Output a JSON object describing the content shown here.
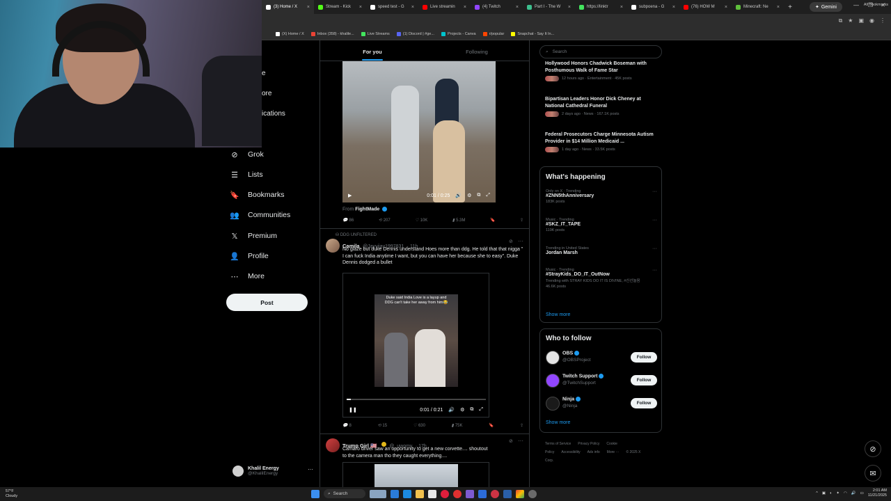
{
  "browser": {
    "tabs": [
      {
        "label": "(3) Home / X",
        "color": "#ffffff",
        "active": true
      },
      {
        "label": "Stream - Kick",
        "color": "#53fc18"
      },
      {
        "label": "speed test - G",
        "color": "#ffffff"
      },
      {
        "label": "Live streamin",
        "color": "#ff0000"
      },
      {
        "label": "(4) Twitch",
        "color": "#9146ff"
      },
      {
        "label": "Part I - The W",
        "color": "#3dbf8e"
      },
      {
        "label": "https://linktr",
        "color": "#43e55e"
      },
      {
        "label": "subpoena - G",
        "color": "#ffffff"
      },
      {
        "label": "(76) HOW M",
        "color": "#ff0000"
      },
      {
        "label": "Minecraft: Ne",
        "color": "#5fbf3c"
      }
    ],
    "gemini_label": "Gemini",
    "bookmarks": [
      {
        "label": "(X) Home / X",
        "color": "#ffffff"
      },
      {
        "label": "Inbox (358) - khalile...",
        "color": "#ea4335"
      },
      {
        "label": "Live Streams",
        "color": "#43e55e"
      },
      {
        "label": "(1) Discord | #ge...",
        "color": "#5865f2"
      },
      {
        "label": "Projects - Canva",
        "color": "#00c4cc"
      },
      {
        "label": "r/popular",
        "color": "#ff4500"
      },
      {
        "label": "Snapchat - Say It In...",
        "color": "#fffc00"
      }
    ],
    "all_bookmarks": "All Bookmarks"
  },
  "sidebar": {
    "partial": [
      "e",
      "ore",
      "ications"
    ],
    "items": [
      {
        "label": "Grok",
        "icon": "grok-icon",
        "glyph": "⊘"
      },
      {
        "label": "Lists",
        "icon": "lists-icon",
        "glyph": "☰"
      },
      {
        "label": "Bookmarks",
        "icon": "bookmark-icon",
        "glyph": "🔖"
      },
      {
        "label": "Communities",
        "icon": "communities-icon",
        "glyph": "👥"
      },
      {
        "label": "Premium",
        "icon": "x-logo-icon",
        "glyph": "𝕏"
      },
      {
        "label": "Profile",
        "icon": "profile-icon",
        "glyph": "👤"
      },
      {
        "label": "More",
        "icon": "more-icon",
        "glyph": "⋯"
      }
    ],
    "post_label": "Post",
    "account": {
      "name": "Khalil Energy",
      "handle": "@KhalilEnergy"
    }
  },
  "feed": {
    "tabs": [
      "For you",
      "Following"
    ],
    "tweet1": {
      "video_time": "0:01 / 0:25",
      "from_label": "From",
      "from_name": "FightMade",
      "replies": "86",
      "reposts": "207",
      "likes": "10K",
      "views": "5.3M"
    },
    "tweet2": {
      "context": "DDG UNFILTERED",
      "name": "Camila",
      "handle": "@Jayvijay1997831",
      "time": "· 11h",
      "text": "No glaze but duke Dennis understand Hoes more than ddg. He told that that nigga \" I can fuck India anytime I want, but you can have her because she to easy\". Duke Dennis dodged a bullet",
      "caption": "Duke said India Love is a layup and DDG can't take her away from him😂",
      "video_time": "0:01 / 0:21",
      "replies": "8",
      "reposts": "15",
      "likes": "630",
      "views": "75K"
    },
    "tweet3": {
      "name": "Trump Girl 🇺🇸",
      "handle": "@_uwomy",
      "time": "· 17h",
      "text": "Camaro driver saw an opportunity to get a new corvette.... shoutout to the camera man tho they caught everything...."
    }
  },
  "right": {
    "search_placeholder": "Search",
    "news": [
      {
        "title": "Hollywood Honors Chadwick Boseman with Posthumous Walk of Fame Star",
        "meta": "12 hours ago · Entertainment · 45K posts"
      },
      {
        "title": "Bipartisan Leaders Honor Dick Cheney at National Cathedral Funeral",
        "meta": "2 days ago · News · 167.1K posts"
      },
      {
        "title": "Federal Prosecutors Charge Minnesota Autism Provider in $14 Million Medicaid ...",
        "meta": "1 day ago · News · 33.5K posts"
      }
    ],
    "whats_happening": "What's happening",
    "trends": [
      {
        "context": "Only on X · Trending",
        "name": "#ZNN5thAnniversary",
        "posts": "183K posts"
      },
      {
        "context": "Music · Trending",
        "name": "#SKZ_IT_TAPE",
        "posts": "119K posts"
      },
      {
        "context": "Trending in United States",
        "name": "Jordan Marsh",
        "posts": ""
      },
      {
        "context": "Music · Trending",
        "name": "#StrayKids_DO_IT_OutNow",
        "extra": "Trending with STRAY KIDS DO IT IS DIVINE, #신선놀음",
        "posts": "46.6K posts"
      }
    ],
    "show_more": "Show more",
    "who_to_follow": "Who to follow",
    "follow_label": "Follow",
    "follows": [
      {
        "name": "OBS",
        "handle": "@OBSProject",
        "color": "#e5e5e5"
      },
      {
        "name": "Twitch Support",
        "handle": "@TwitchSupport",
        "color": "#9146ff"
      },
      {
        "name": "Ninja",
        "handle": "@Ninja",
        "color": "#1a1a1a"
      }
    ],
    "footer": [
      "Terms of Service",
      "Privacy Policy",
      "Cookie Policy",
      "Accessibility",
      "Ads info",
      "More ···",
      "© 2025 X Corp."
    ]
  },
  "taskbar": {
    "weather_temp": "57°F",
    "weather_desc": "Cloudy",
    "search_label": "Search",
    "time": "2:01 AM",
    "date": "11/21/2025"
  }
}
